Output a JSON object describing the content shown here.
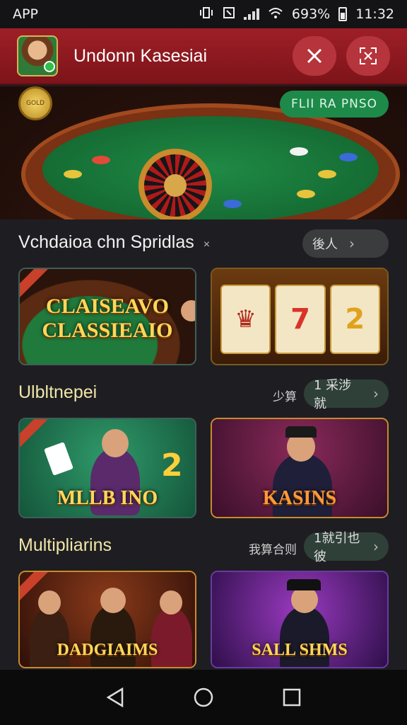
{
  "status_bar": {
    "carrier": "APP",
    "battery": "693%",
    "time": "11:32"
  },
  "header": {
    "title": "Undonn Kasesiai",
    "close_icon": "close-icon",
    "expand_icon": "expand-icon"
  },
  "hero": {
    "coin_label": "GOLD",
    "badge": "FLII RA PNSO"
  },
  "sections": [
    {
      "title": "Vchdaioa chn Spridlas",
      "title_suffix": "×",
      "more_label": "",
      "pill_label": "後人",
      "cards": [
        {
          "caption": "CLAISEAVO CLASSIEAIO"
        },
        {
          "caption": ""
        }
      ]
    },
    {
      "title": "Ulbltnepei",
      "more_label": "少算",
      "pill_label": "1 采涉就",
      "cards": [
        {
          "caption": "MLLB INO"
        },
        {
          "caption": "KASINS"
        }
      ]
    },
    {
      "title": "Multipliarins",
      "more_label": "我算合则",
      "pill_label": "1就引也彼",
      "cards": [
        {
          "caption": "DADGIAIMS"
        },
        {
          "caption": "SALL SHMS"
        }
      ]
    }
  ],
  "nav": {
    "back": "back-icon",
    "home": "home-icon",
    "recents": "recents-icon"
  },
  "colors": {
    "header_red": "#9e1f26",
    "badge_green": "#1d8a4a",
    "background": "#1e1e22",
    "caption_gold": "#ffd75a"
  }
}
